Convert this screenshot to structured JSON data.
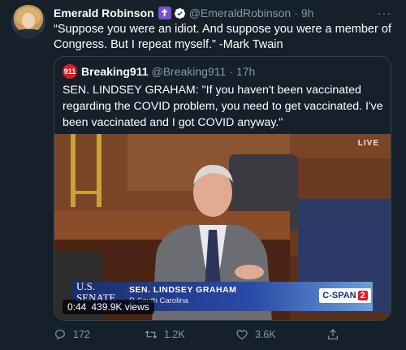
{
  "tweet": {
    "author_name": "Emerald Robinson",
    "badge_glyph": "✝",
    "handle": "@EmeraldRobinson",
    "separator": "·",
    "time": "9h",
    "more_glyph": "···",
    "text": "“Suppose you were an idiot. And suppose you were a member of Congress. But I repeat myself.” -Mark Twain"
  },
  "quoted": {
    "avatar_text": "911",
    "name": "Breaking911",
    "handle": "@Breaking911",
    "separator": "·",
    "time": "17h",
    "text": "SEN. LINDSEY GRAHAM: \"If you haven't been vaccinated regarding the COVID problem, you need to get vaccinated. I've been vaccinated and I got COVID anyway.\"",
    "video": {
      "live_label": "LIVE",
      "senate_logo_text": "U.S. SENATE",
      "chyron_name": "SEN. LINDSEY GRAHAM",
      "chyron_sub": "R-South Carolina",
      "network_text": "C-SPAN",
      "network_number": "2",
      "duration": "0:44",
      "views": "439.9K views"
    }
  },
  "actions": {
    "reply_count": "172",
    "retweet_count": "1.2K",
    "like_count": "3.6K",
    "reply_icon": "reply-icon",
    "retweet_icon": "retweet-icon",
    "like_icon": "heart-icon",
    "share_icon": "share-icon"
  },
  "colors": {
    "background": "#15202b",
    "muted_text": "#8899a6",
    "border": "#38444d",
    "verified_blue": "#1da1f2"
  }
}
